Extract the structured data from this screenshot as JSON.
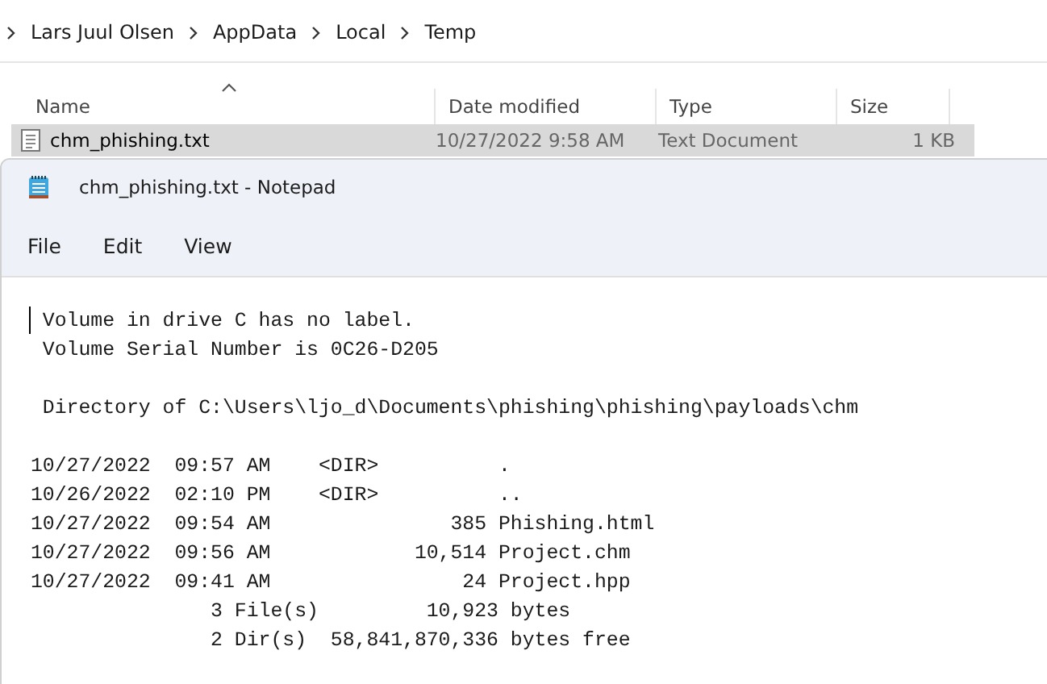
{
  "breadcrumb": [
    "Lars Juul Olsen",
    "AppData",
    "Local",
    "Temp"
  ],
  "columns": [
    {
      "label": "Name",
      "sorted": true
    },
    {
      "label": "Date modified",
      "sorted": false
    },
    {
      "label": "Type",
      "sorted": false
    },
    {
      "label": "Size",
      "sorted": false
    }
  ],
  "files": [
    {
      "name": "chm_phishing.txt",
      "date": "10/27/2022 9:58 AM",
      "type": "Text Document",
      "size": "1 KB",
      "selected": true
    }
  ],
  "notepad": {
    "title": "chm_phishing.txt - Notepad",
    "menu": [
      "File",
      "Edit",
      "View"
    ],
    "blocks": [
      [
        " Volume in drive C has no label.",
        " Volume Serial Number is 0C26-D205"
      ],
      [
        " Directory of C:\\Users\\ljo_d\\Documents\\phishing\\phishing\\payloads\\chm"
      ],
      [
        "10/27/2022  09:57 AM    <DIR>          .",
        "10/26/2022  02:10 PM    <DIR>          ..",
        "10/27/2022  09:54 AM               385 Phishing.html",
        "10/27/2022  09:56 AM            10,514 Project.chm",
        "10/27/2022  09:41 AM                24 Project.hpp",
        "               3 File(s)         10,923 bytes",
        "               2 Dir(s)  58,841,870,336 bytes free"
      ]
    ]
  }
}
